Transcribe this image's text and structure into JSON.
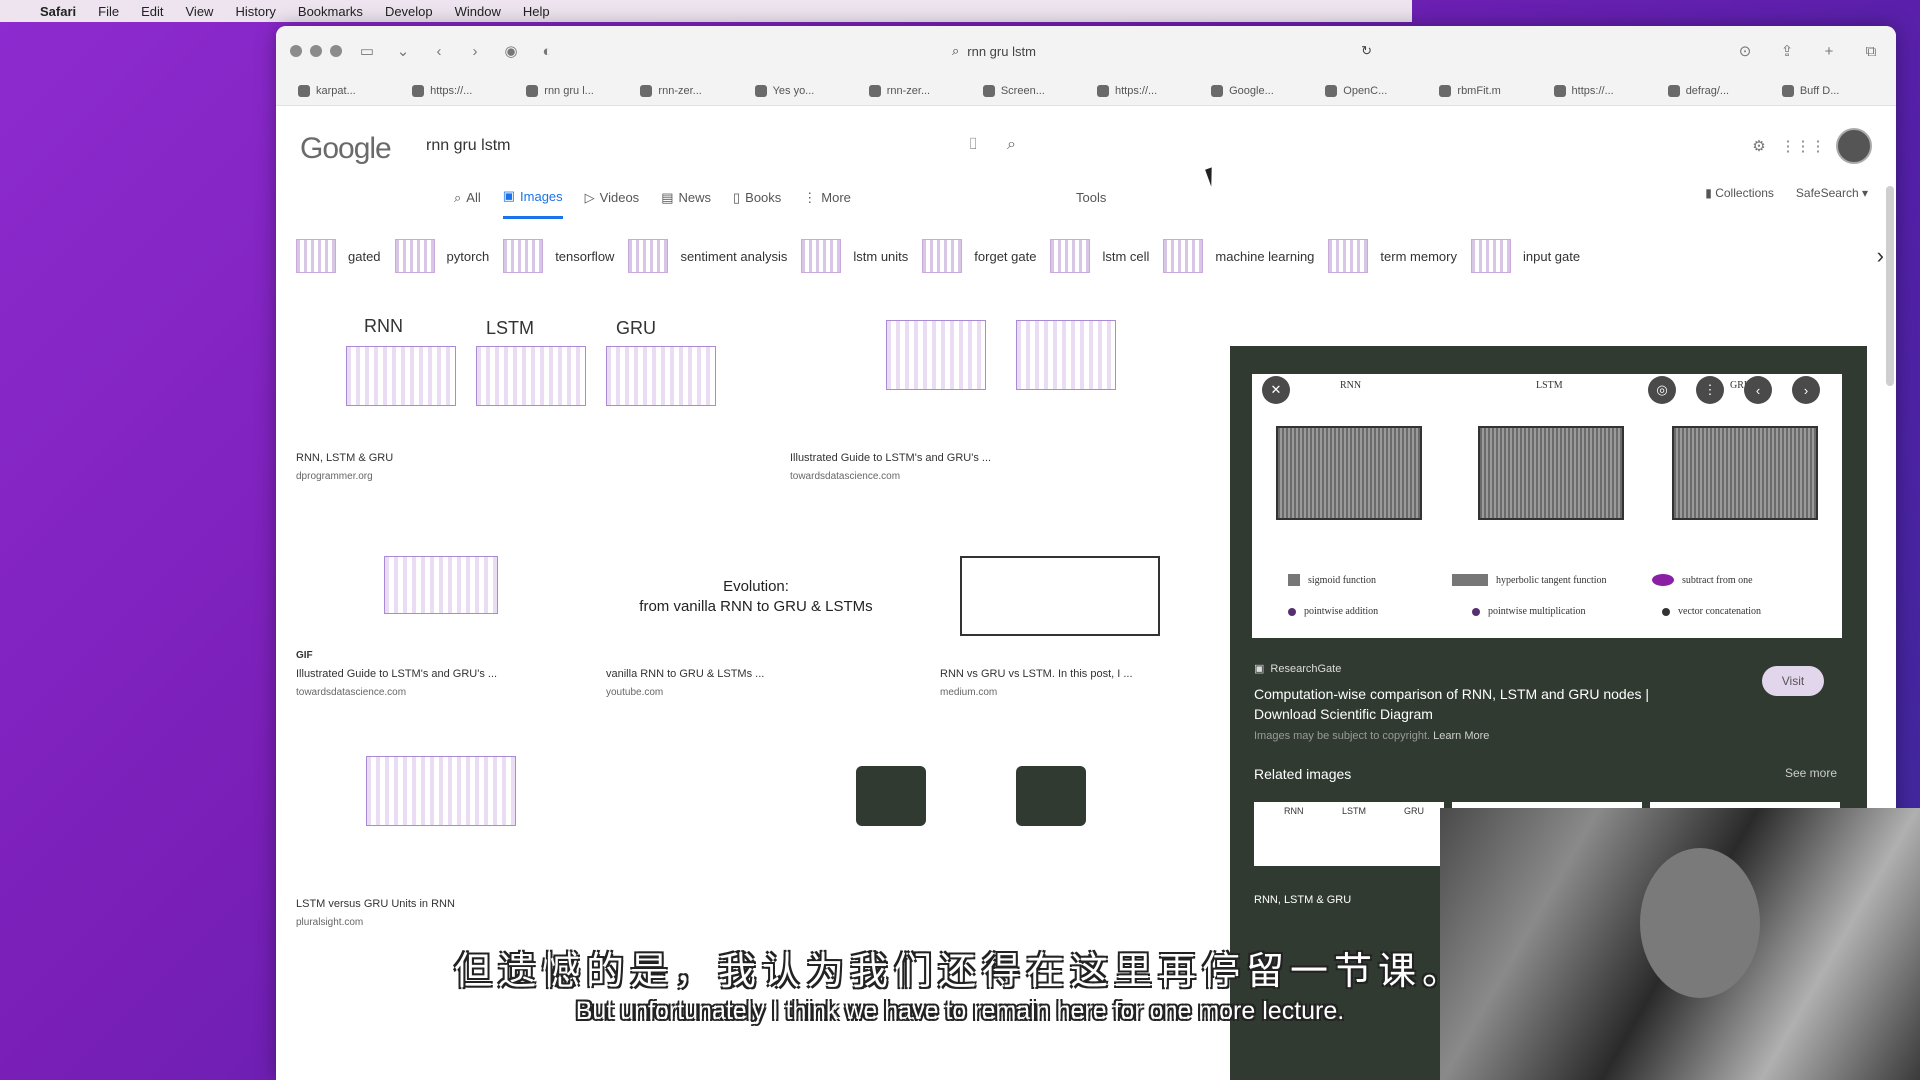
{
  "menubar": {
    "app": "Safari",
    "items": [
      "File",
      "Edit",
      "View",
      "History",
      "Bookmarks",
      "Develop",
      "Window",
      "Help"
    ]
  },
  "browser": {
    "address": "rnn gru lstm",
    "favorites": [
      "karpat...",
      "https://...",
      "rnn gru l...",
      "rnn-zer...",
      "Yes yo...",
      "rnn-zer...",
      "Screen...",
      "https://...",
      "Google...",
      "OpenC...",
      "rbmFit.m",
      "https://...",
      "defrag/...",
      "Buff D..."
    ]
  },
  "google": {
    "logo": "Google",
    "query": "rnn gru lstm",
    "tabs": [
      "All",
      "Images",
      "Videos",
      "News",
      "Books",
      "More"
    ],
    "active_tab": "Images",
    "tools": "Tools",
    "collections": "Collections",
    "safesearch": "SafeSearch ▾",
    "chips": [
      "gated",
      "pytorch",
      "tensorflow",
      "sentiment analysis",
      "lstm units",
      "forget gate",
      "lstm cell",
      "machine learning",
      "term memory",
      "input gate"
    ]
  },
  "results": [
    {
      "caption": "RNN, LSTM & GRU",
      "source": "dprogrammer.org",
      "labels": [
        "RNN",
        "LSTM",
        "GRU"
      ]
    },
    {
      "caption": "Illustrated Guide to LSTM's and GRU's ...",
      "source": "towardsdatascience.com"
    },
    {
      "caption": "Illustrated Guide to LSTM's and GRU's ...",
      "source": "towardsdatascience.com",
      "badge": "GIF"
    },
    {
      "caption": "vanilla RNN to GRU & LSTMs ...",
      "source": "youtube.com",
      "overlay_title": "Evolution:",
      "overlay_sub": "from vanilla RNN to GRU & LSTMs"
    },
    {
      "caption": "RNN vs GRU vs LSTM. In this post, I ...",
      "source": "medium.com"
    },
    {
      "caption": "LSTM versus GRU Units in RNN",
      "source": "pluralsight.com"
    }
  ],
  "preview": {
    "diagram_titles": [
      "RNN",
      "LSTM",
      "GRU"
    ],
    "legend": [
      "sigmoid function",
      "hyperbolic tangent function",
      "subtract from one",
      "pointwise addition",
      "pointwise multiplication",
      "vector concatenation"
    ],
    "source": "ResearchGate",
    "heading": "Computation-wise comparison of RNN, LSTM and GRU nodes | Download Scientific Diagram",
    "copyright": "Images may be subject to copyright.",
    "learn_more": "Learn More",
    "visit": "Visit",
    "related": "Related images",
    "see_more": "See more",
    "related_caption": "RNN, LSTM & GRU",
    "related_labels": [
      "RNN",
      "LSTM",
      "GRU"
    ]
  },
  "subtitles": {
    "zh": "但遗憾的是，我认为我们还得在这里再停留一节课。",
    "en": "But unfortunately I think we have to remain here for one more lecture."
  }
}
